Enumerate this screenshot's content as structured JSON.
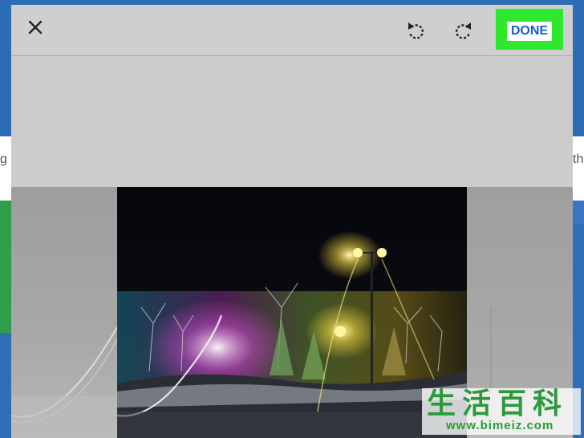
{
  "background": {
    "left_peek_text": "g",
    "right_peek_text": "th"
  },
  "toolbar": {
    "close_icon": "close-icon",
    "rotate_left_icon": "rotate-left-icon",
    "rotate_right_icon": "rotate-right-icon",
    "done_label": "DONE",
    "done_highlight_color": "#2ee82e",
    "done_text_color": "#1a5fd0"
  },
  "watermark": {
    "chars": "生活百科",
    "url": "www.bimeiz.com",
    "color": "#2a9a3a"
  }
}
